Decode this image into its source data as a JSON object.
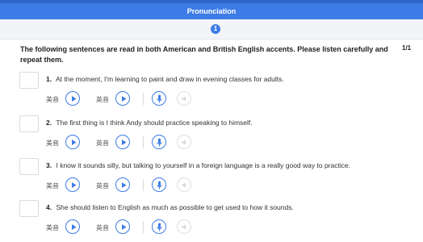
{
  "header": {
    "title": "Pronunciation"
  },
  "pager": {
    "current": "1",
    "count": "1/1"
  },
  "instructions": "The following sentences are read in both American and British English accents. Please listen carefully and repeat them.",
  "labels": {
    "american": "美音",
    "british": "英音"
  },
  "icons": {
    "play": "play-icon",
    "record": "microphone-icon",
    "playback": "speaker-icon"
  },
  "colors": {
    "accent": "#3d7ce6",
    "disabled": "#dcdfe4"
  },
  "items": [
    {
      "num": "1.",
      "text": "At the moment, I'm learning to paint and draw in evening classes for adults."
    },
    {
      "num": "2.",
      "text": "The first thing is I think Andy should practice speaking to himself."
    },
    {
      "num": "3.",
      "text": "I know it sounds silly, but talking to yourself in a foreign language is a really good way to practice."
    },
    {
      "num": "4.",
      "text": "She should listen to English as much as possible to get used to how it sounds."
    }
  ]
}
